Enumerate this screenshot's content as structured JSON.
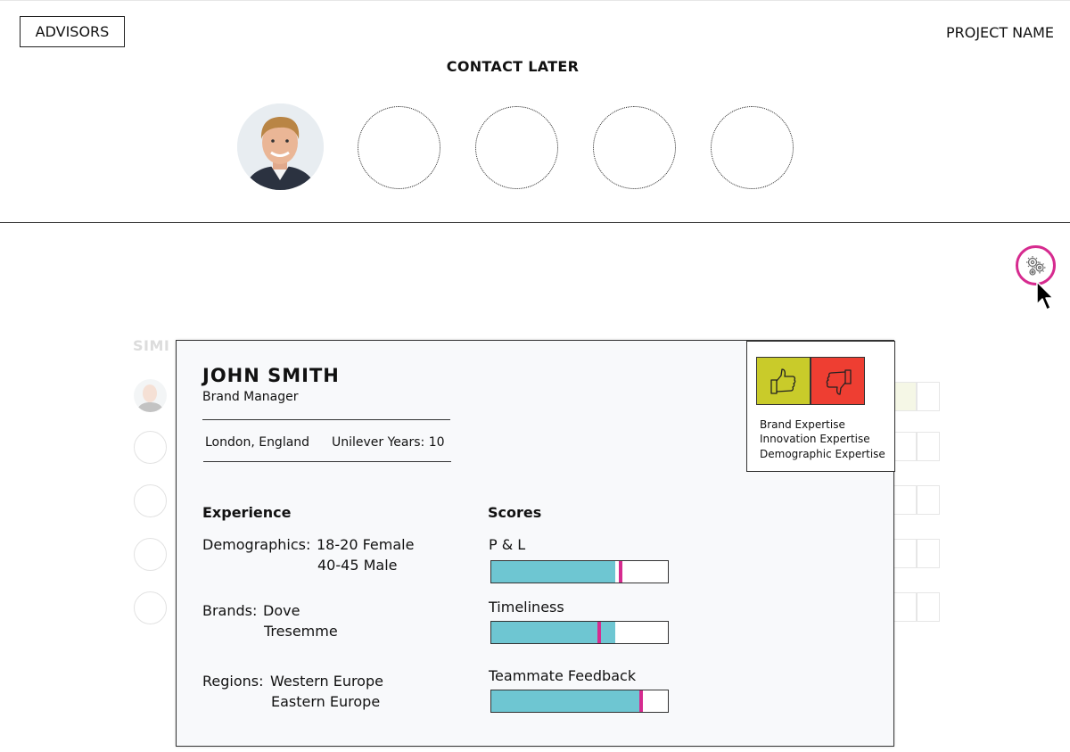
{
  "header": {
    "advisors_label": "ADVISORS",
    "project_name": "PROJECT NAME",
    "contact_later_heading": "CONTACT LATER"
  },
  "background_list": {
    "heading": "SIMI"
  },
  "profile": {
    "name": "JOHN SMITH",
    "title": "Brand Manager",
    "location": "London, England",
    "company_years": "Unilever Years: 10",
    "experience": {
      "heading": "Experience",
      "demographics_label": "Demographics:",
      "demographics": [
        "18-20 Female",
        "40-45 Male"
      ],
      "brands_label": "Brands:",
      "brands": [
        "Dove",
        "Tresemme"
      ],
      "regions_label": "Regions:",
      "regions": [
        "Western Europe",
        "Eastern Europe"
      ]
    },
    "scores": {
      "heading": "Scores",
      "items": [
        {
          "label": "P & L",
          "fill_pct": 70,
          "marker_pct": 73
        },
        {
          "label": "Timeliness",
          "fill_pct": 70,
          "marker_pct": 61
        },
        {
          "label": "Teammate Feedback",
          "fill_pct": 85,
          "marker_pct": 85
        }
      ]
    },
    "expertise": [
      "Brand Expertise",
      "Innovation Expertise",
      "Demographic Expertise"
    ]
  },
  "colors": {
    "accent": "#d62b8f",
    "bar_fill": "#6ec6d2",
    "thumbs_up": "#c9cb2a",
    "thumbs_down": "#ee3e32"
  },
  "icons": {
    "settings": "gears-icon",
    "cursor": "mouse-pointer-icon",
    "like": "thumbs-up-icon",
    "dislike": "thumbs-down-icon"
  }
}
